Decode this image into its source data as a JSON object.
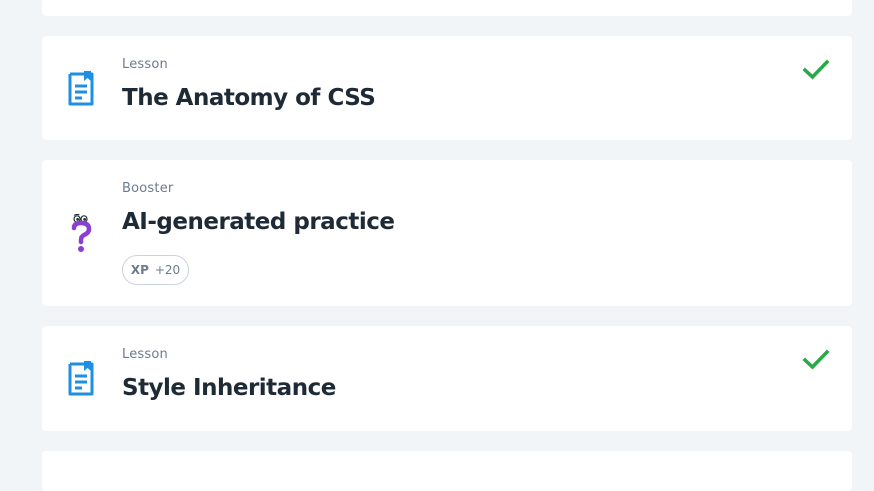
{
  "colors": {
    "page_bg": "#f2f5f7",
    "card_bg": "#ffffff",
    "lesson_icon": "#1e8fe1",
    "booster_icon": "#8a3fd1",
    "check": "#2aa84a",
    "title_text": "#1e2a36",
    "kind_text": "#6b7c8f"
  },
  "items": [
    {
      "kind": "Lesson",
      "title": "The Anatomy of CSS",
      "icon": "lesson-book-icon",
      "completed": true
    },
    {
      "kind": "Booster",
      "title": "AI-generated practice",
      "icon": "question-mark-character-icon",
      "completed": false,
      "xp": {
        "label": "XP",
        "value": "+20"
      }
    },
    {
      "kind": "Lesson",
      "title": "Style Inheritance",
      "icon": "lesson-book-icon",
      "completed": true
    }
  ]
}
